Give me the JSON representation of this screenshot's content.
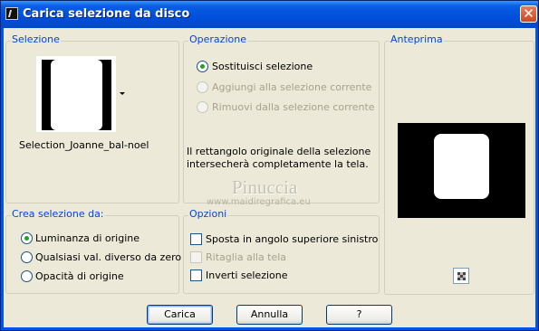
{
  "window": {
    "title": "Carica selezione da disco",
    "close_glyph": "✕"
  },
  "selection_group": {
    "title": "Selezione",
    "selected_name": "Selection_Joanne_bal-noel",
    "dropdown_icon": "chevron-down-icon"
  },
  "operation_group": {
    "title": "Operazione",
    "options": [
      {
        "label": "Sostituisci selezione",
        "selected": true,
        "enabled": true
      },
      {
        "label": "Aggiungi alla selezione corrente",
        "selected": false,
        "enabled": false
      },
      {
        "label": "Rimuovi dalla selezione corrente",
        "selected": false,
        "enabled": false
      }
    ],
    "note_line1": "Il rettangolo originale della selezione",
    "note_line2": "intersecherà completamente la tela."
  },
  "preview_group": {
    "title": "Anteprima",
    "zoom_icon": "zoom-icon"
  },
  "create_group": {
    "title": "Crea selezione da:",
    "options": [
      {
        "label": "Luminanza di origine",
        "selected": true
      },
      {
        "label": "Qualsiasi val. diverso da zero",
        "selected": false
      },
      {
        "label": "Opacità di origine",
        "selected": false
      }
    ]
  },
  "options_group": {
    "title": "Opzioni",
    "items": [
      {
        "label": "Sposta in angolo superiore sinistro",
        "checked": false,
        "enabled": true
      },
      {
        "label": "Ritaglia alla tela",
        "checked": false,
        "enabled": false
      },
      {
        "label": "Inverti selezione",
        "checked": false,
        "enabled": true
      }
    ]
  },
  "watermark": {
    "line1": "Pinuccia",
    "line2": "www.maidiregrafica.eu"
  },
  "buttons": {
    "load": "Carica",
    "cancel": "Annulla",
    "help": "?"
  }
}
